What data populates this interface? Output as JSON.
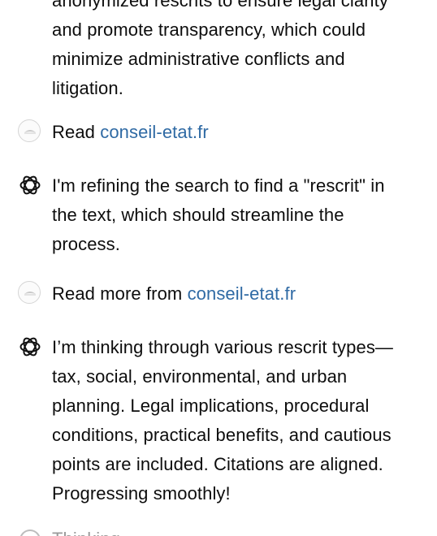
{
  "blocks": {
    "intro": {
      "lines": [
        "anonymized rescrits to ensure legal clarity",
        "and promote transparency, which could",
        "minimize administrative conflicts and",
        "litigation."
      ]
    },
    "read1": {
      "prefix": "Read ",
      "link": "conseil-etat.fr"
    },
    "thought1": {
      "lines": [
        "I'm refining the search to find a \"rescrit\" in",
        "the text, which should streamline the",
        "process."
      ]
    },
    "read2": {
      "prefix": "Read more from ",
      "link": "conseil-etat.fr"
    },
    "thought2": {
      "lines": [
        "I’m thinking through various rescrit types—",
        "tax, social, environmental, and urban",
        "planning. Legal implications, procedural",
        "conditions, practical benefits, and cautious",
        "points are included. Citations are aligned.",
        "Progressing smoothly!"
      ]
    },
    "bottom": {
      "text": "Thinking"
    }
  }
}
